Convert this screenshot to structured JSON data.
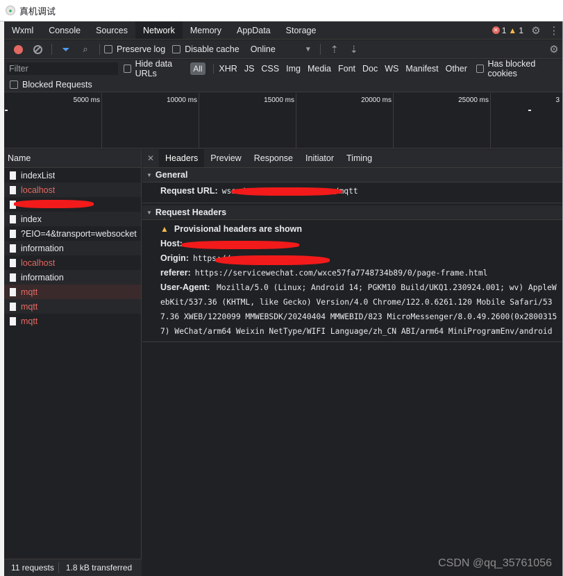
{
  "window": {
    "title": "真机调试"
  },
  "main_tabs": [
    "Wxml",
    "Console",
    "Sources",
    "Network",
    "Memory",
    "AppData",
    "Storage"
  ],
  "active_main_tab": "Network",
  "badges": {
    "errors": "1",
    "warnings": "1"
  },
  "toolbar": {
    "preserve_log": "Preserve log",
    "disable_cache": "Disable cache",
    "throttling": "Online"
  },
  "filter": {
    "placeholder": "Filter",
    "hide_data_urls": "Hide data URLs",
    "all": "All",
    "types": [
      "XHR",
      "JS",
      "CSS",
      "Img",
      "Media",
      "Font",
      "Doc",
      "WS",
      "Manifest",
      "Other"
    ],
    "has_blocked_cookies": "Has blocked cookies",
    "blocked_requests": "Blocked Requests"
  },
  "overview": {
    "ticks": [
      "5000 ms",
      "10000 ms",
      "15000 ms",
      "20000 ms",
      "25000 ms",
      "3"
    ]
  },
  "request_list": {
    "header": "Name",
    "rows": [
      {
        "name": "indexList",
        "failed": false
      },
      {
        "name": "localhost",
        "failed": true
      },
      {
        "name": "",
        "failed": false,
        "redacted": true
      },
      {
        "name": "index",
        "failed": false
      },
      {
        "name": "?EIO=4&transport=websocket",
        "failed": false
      },
      {
        "name": "information",
        "failed": false
      },
      {
        "name": "localhost",
        "failed": true
      },
      {
        "name": "information",
        "failed": false
      },
      {
        "name": "mqtt",
        "failed": true,
        "selected": true
      },
      {
        "name": "mqtt",
        "failed": true
      },
      {
        "name": "mqtt",
        "failed": true
      }
    ]
  },
  "status": {
    "requests": "11 requests",
    "transferred": "1.8 kB transferred"
  },
  "detail_tabs": [
    "Headers",
    "Preview",
    "Response",
    "Initiator",
    "Timing"
  ],
  "active_detail_tab": "Headers",
  "general": {
    "title": "General",
    "request_url_label": "Request URL:",
    "request_url_prefix": "wss:/",
    "request_url_suffix": "/mqtt"
  },
  "request_headers": {
    "title": "Request Headers",
    "provisional_warning": "Provisional headers are shown",
    "host_label": "Host:",
    "origin_label": "Origin:",
    "origin_value": "https://",
    "referer_label": "referer:",
    "referer_value": "https://servicewechat.com/wxce57fa7748734b89/0/page-frame.html",
    "user_agent_label": "User-Agent:",
    "user_agent_value": "Mozilla/5.0 (Linux; Android 14; PGKM10 Build/UKQ1.230924.001; wv) AppleWebKit/537.36 (KHTML, like Gecko) Version/4.0 Chrome/122.0.6261.120 Mobile Safari/537.36 XWEB/1220099 MMWEBSDK/20240404 MMWEBID/823 MicroMessenger/8.0.49.2600(0x28003157) WeChat/arm64 Weixin NetType/WIFI Language/zh_CN ABI/arm64 MiniProgramEnv/android"
  },
  "watermark": "CSDN @qq_35761056",
  "colors": {
    "accent": "#4d9af4",
    "error": "#e46962",
    "warning": "#f2b94b",
    "background": "#202124"
  }
}
